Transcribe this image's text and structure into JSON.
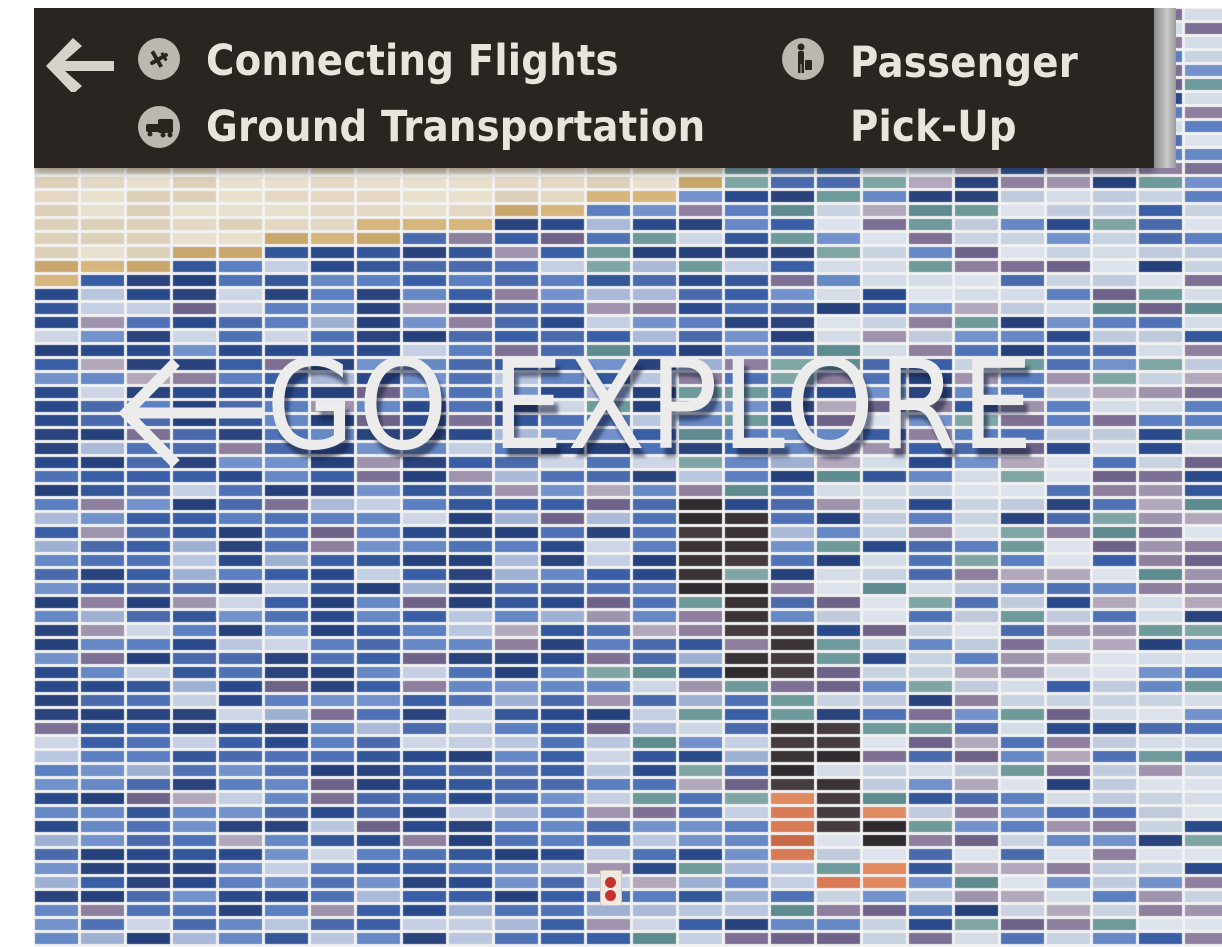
{
  "sign": {
    "left_items": [
      {
        "label": "Connecting Flights",
        "icon": "airplane-icon"
      },
      {
        "label": "Ground Transportation",
        "icon": "car-bus-icon"
      }
    ],
    "right_item": {
      "line1": "Passenger",
      "line2": "Pick-Up",
      "icon": "person-luggage-icon"
    },
    "arrow_icon": "left-arrow-icon"
  },
  "wall": {
    "title": "GO EXPLORE",
    "arrow_icon": "left-arrow-icon"
  },
  "colors": {
    "sign_bg": "#2b2521",
    "sign_text": "#e9e5dd",
    "tile_navy": "#2f4f8f",
    "tile_blue": "#5578b8",
    "tile_light": "#b4c2dd",
    "tile_mauve": "#9c8ea8",
    "tile_teal": "#6f9a9c",
    "tile_dark": "#3b3236",
    "tile_orange": "#d77a55",
    "tile_sand": "#d9c39a"
  }
}
